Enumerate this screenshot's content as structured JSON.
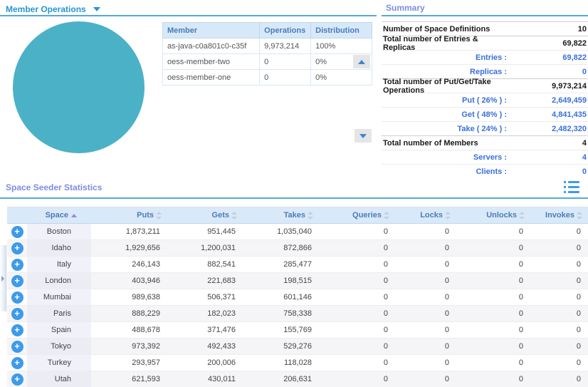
{
  "theme": {
    "pie_color": "#4BB1C7",
    "accent_blue": "#3D9BE9",
    "header_underline": "#55A8DC",
    "section_title_cyan": "#2795D2",
    "section_title_lavender": "#7B8DE2",
    "table_header_bg": "#D9E9F8",
    "summary_sub_color": "#3A6FD8"
  },
  "member_operations": {
    "title": "Member Operations",
    "pie_color": "#4BB1C7",
    "table": {
      "columns": [
        "Member",
        "Operations",
        "Distribution"
      ],
      "rows": [
        {
          "member": "as-java-c0a801c0-c35f",
          "operations": "9,973,214",
          "distribution": "100%"
        },
        {
          "member": "oess-member-two",
          "operations": "0",
          "distribution": "0%"
        },
        {
          "member": "oess-member-one",
          "operations": "0",
          "distribution": "0%"
        }
      ]
    }
  },
  "summary": {
    "title": "Summary",
    "rows": [
      {
        "label": "Number of Space Definitions",
        "value": "10",
        "style": "bold"
      },
      {
        "label": "Total number of Entries & Replicas",
        "value": "69,822",
        "style": "bold"
      },
      {
        "label": "Entries :",
        "value": "69,822",
        "style": "sub"
      },
      {
        "label": "Replicas :",
        "value": "0",
        "style": "sub"
      },
      {
        "label": "Total number of Put/Get/Take Operations",
        "value": "9,973,214",
        "style": "bold"
      },
      {
        "label": "Put ( 26% ) :",
        "value": "2,649,459",
        "style": "sub"
      },
      {
        "label": "Get ( 48% ) :",
        "value": "4,841,435",
        "style": "sub"
      },
      {
        "label": "Take ( 24% ) :",
        "value": "2,482,320",
        "style": "sub"
      },
      {
        "label": "Total number of Members",
        "value": "4",
        "style": "bold"
      },
      {
        "label": "Servers :",
        "value": "4",
        "style": "sub"
      },
      {
        "label": "Clients :",
        "value": "0",
        "style": "sub"
      }
    ]
  },
  "space_seeder": {
    "title": "Space Seeder Statistics",
    "columns": [
      "Space",
      "Puts",
      "Gets",
      "Takes",
      "Queries",
      "Locks",
      "Unlocks",
      "Invokes"
    ],
    "sorted_column": "Space",
    "rows": [
      [
        "Boston",
        "1,873,211",
        "951,445",
        "1,035,040",
        "0",
        "0",
        "0",
        "0"
      ],
      [
        "Idaho",
        "1,929,656",
        "1,200,031",
        "872,866",
        "0",
        "0",
        "0",
        "0"
      ],
      [
        "Italy",
        "246,143",
        "882,541",
        "285,477",
        "0",
        "0",
        "0",
        "0"
      ],
      [
        "London",
        "403,946",
        "221,683",
        "198,515",
        "0",
        "0",
        "0",
        "0"
      ],
      [
        "Mumbai",
        "989,638",
        "506,371",
        "601,146",
        "0",
        "0",
        "0",
        "0"
      ],
      [
        "Paris",
        "888,229",
        "182,023",
        "758,338",
        "0",
        "0",
        "0",
        "0"
      ],
      [
        "Spain",
        "488,678",
        "371,476",
        "155,769",
        "0",
        "0",
        "0",
        "0"
      ],
      [
        "Tokyo",
        "973,392",
        "492,433",
        "529,276",
        "0",
        "0",
        "0",
        "0"
      ],
      [
        "Turkey",
        "293,957",
        "200,006",
        "118,028",
        "0",
        "0",
        "0",
        "0"
      ],
      [
        "Utah",
        "621,593",
        "430,011",
        "206,631",
        "0",
        "0",
        "0",
        "0"
      ]
    ]
  },
  "chart_data": {
    "type": "pie",
    "title": "Member Operations",
    "categories": [
      "as-java-c0a801c0-c35f",
      "oess-member-two",
      "oess-member-one"
    ],
    "values": [
      100,
      0,
      0
    ],
    "unit": "%"
  }
}
